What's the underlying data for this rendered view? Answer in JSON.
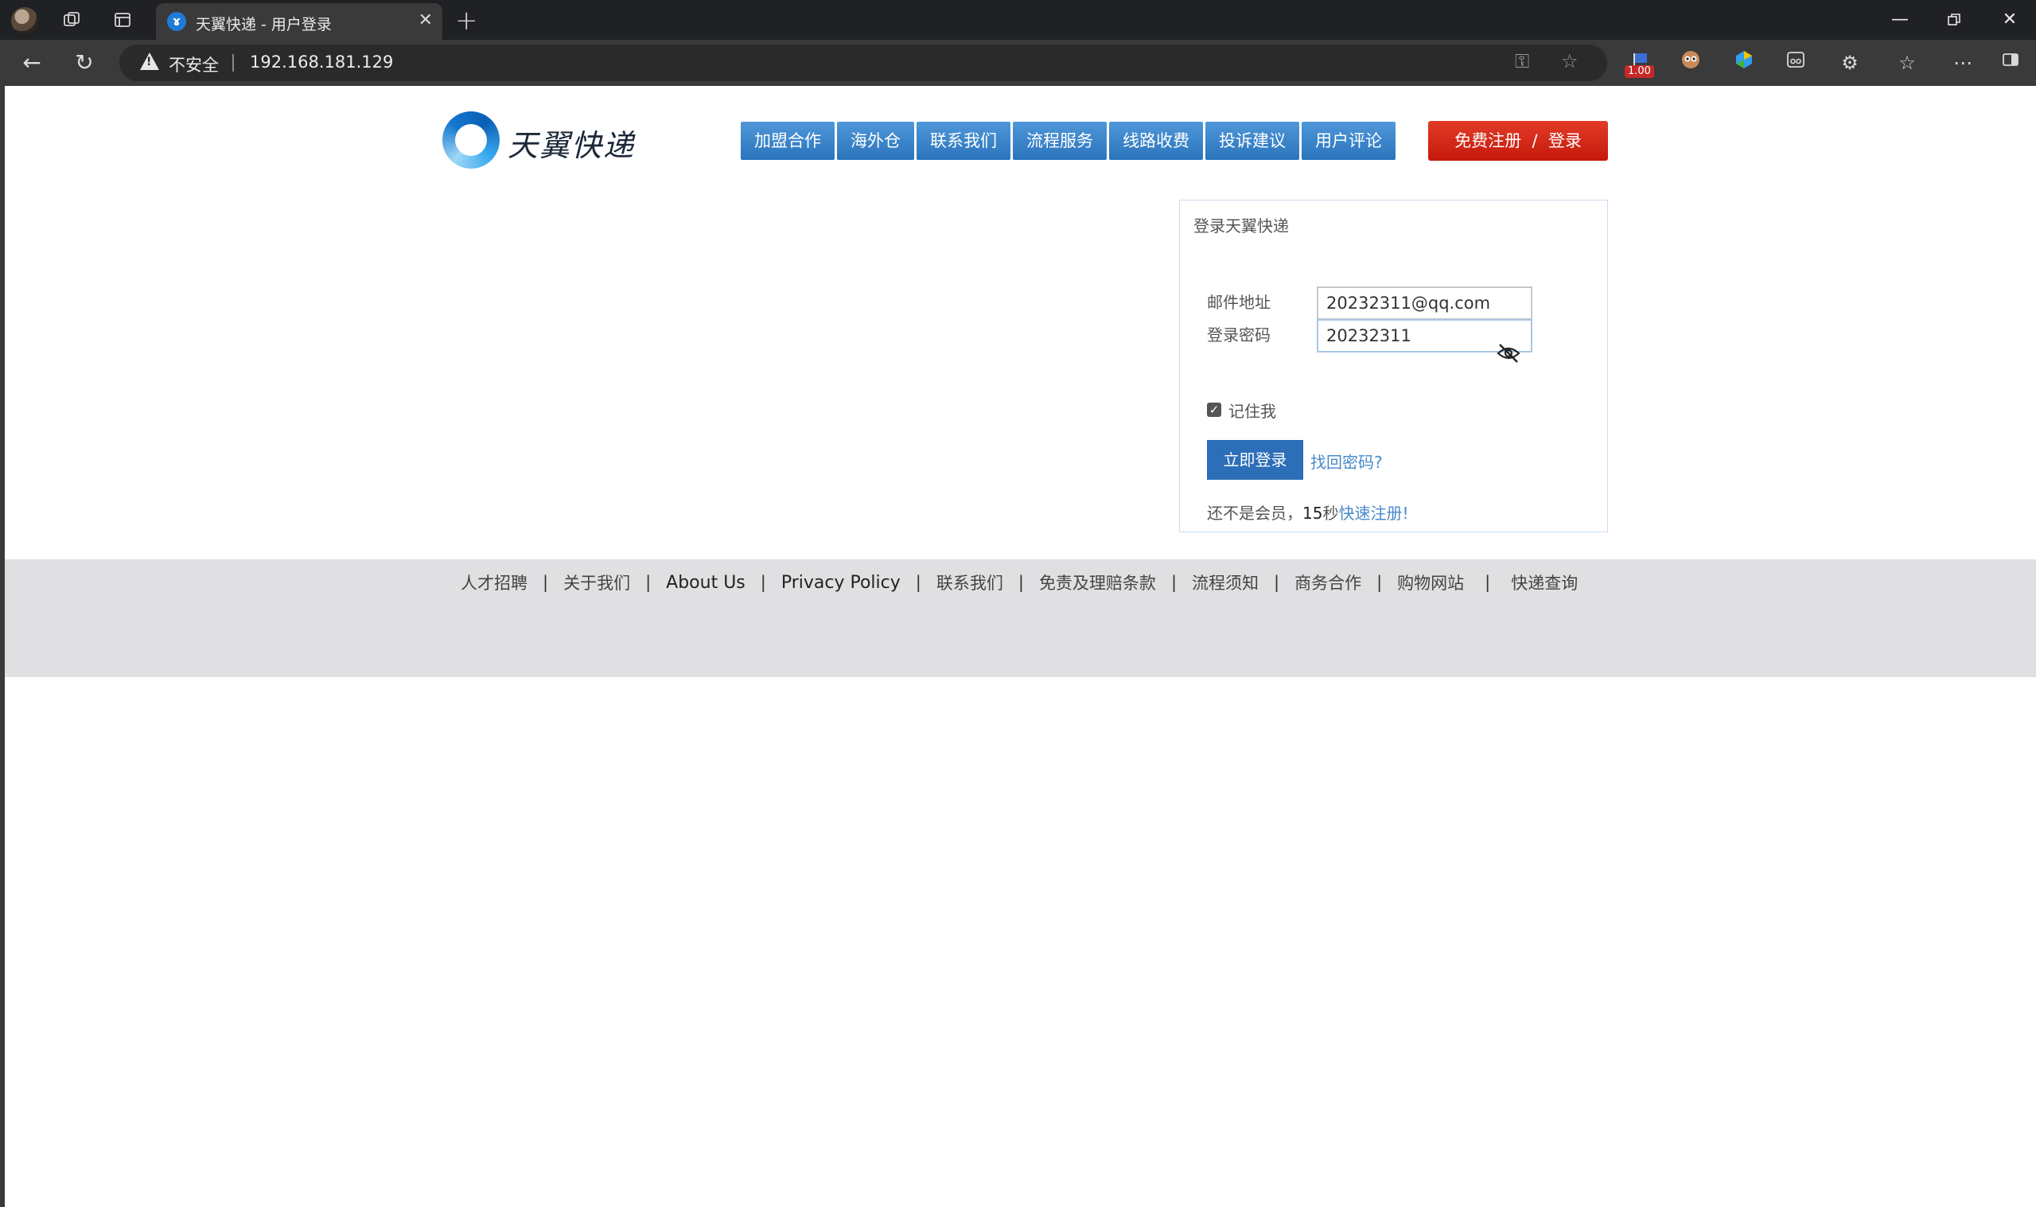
{
  "browser": {
    "tab_title": "天翼快递 - 用户登录",
    "tab_favicon": "telecom-logo-icon",
    "security_label": "不安全",
    "url": "192.168.181.129",
    "extension_badge": "1.00"
  },
  "header": {
    "logo_text": "天翼快递",
    "nav": [
      "加盟合作",
      "海外仓",
      "联系我们",
      "流程服务",
      "线路收费",
      "投诉建议",
      "用户评论"
    ],
    "register_button": "免费注册  /  登录"
  },
  "login": {
    "title": "登录天翼快递",
    "email_label": "邮件地址",
    "email_value": "20232311@qq.com",
    "password_label": "登录密码",
    "password_value": "20232311",
    "remember_label": "记住我",
    "remember_checked": true,
    "submit_label": "立即登录",
    "forgot_label": "找回密码?",
    "register_prefix": "还不是会员，",
    "register_seconds": "15",
    "register_seconds_unit": "秒",
    "register_link": "快速注册!"
  },
  "footer": {
    "links": [
      "人才招聘",
      "关于我们",
      "About Us",
      "Privacy Policy",
      "联系我们",
      "免责及理赔条款",
      "流程须知",
      "商务合作",
      "购物网站",
      "快递查询"
    ]
  },
  "colors": {
    "nav_blue": "#2b74bd",
    "register_red": "#c5190b",
    "submit_blue": "#2c6eb8",
    "link_blue": "#4a8ac9",
    "footer_bg": "#e0e0e2"
  }
}
